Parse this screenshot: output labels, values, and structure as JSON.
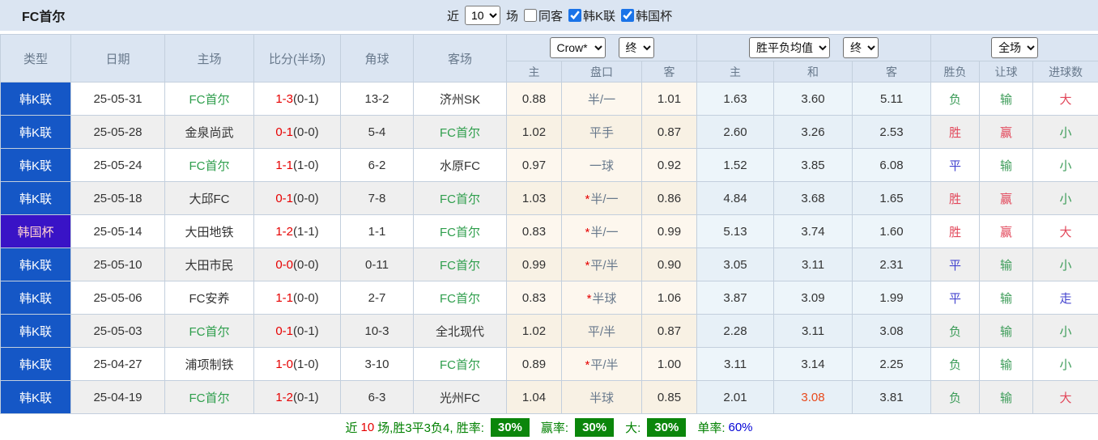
{
  "colors": {
    "league_blue": "#1557c6",
    "cup_purple": "#3913c6",
    "self_green": "#2e9e4c",
    "score_red": "#e60000",
    "result_red": "#e2475a",
    "result_green": "#3d9c59",
    "result_blue": "#4545cf",
    "mean_highlight": "#e8491c",
    "badge_green": "#0b860b"
  },
  "title": "FC首尔",
  "toolbar": {
    "near_label": "近",
    "count_value": "10",
    "games_label": "场",
    "same_away_label": "同客",
    "league_label": "韩K联",
    "cup_label": "韩国杯",
    "same_away_checked": false,
    "league_checked": true,
    "cup_checked": true
  },
  "header": {
    "col_type": "类型",
    "col_date": "日期",
    "col_home": "主场",
    "col_score": "比分(半场)",
    "col_corner": "角球",
    "col_away": "客场",
    "odds_company_select": "Crow*",
    "odds_final_select": "终",
    "mean_select": "胜平负均值",
    "mean_final_select": "终",
    "scope_select": "全场",
    "sub_odds_home": "主",
    "sub_handicap": "盘口",
    "sub_odds_away": "客",
    "sub_mean_home": "主",
    "sub_mean_draw": "和",
    "sub_mean_away": "客",
    "col_wdl": "胜负",
    "col_handicap_result": "让球",
    "col_goals": "进球数"
  },
  "rows": [
    {
      "type": "韩K联",
      "type_class": "league",
      "date": "25-05-31",
      "home": "FC首尔",
      "home_is_self": true,
      "score": "1-3",
      "half": "(0-1)",
      "corner": "13-2",
      "away": "济州SK",
      "away_is_self": false,
      "odds_home": "0.88",
      "handicap": "半/一",
      "handicap_star": false,
      "odds_away": "1.01",
      "mean_home": "1.63",
      "mean_draw": "3.60",
      "mean_away": "5.11",
      "mean_draw_highlight": false,
      "wdl": "负",
      "wdl_color": "green",
      "hr": "输",
      "hr_color": "green",
      "goals": "大",
      "goals_color": "red"
    },
    {
      "type": "韩K联",
      "type_class": "league",
      "date": "25-05-28",
      "home": "金泉尚武",
      "home_is_self": false,
      "score": "0-1",
      "half": "(0-0)",
      "corner": "5-4",
      "away": "FC首尔",
      "away_is_self": true,
      "odds_home": "1.02",
      "handicap": "平手",
      "handicap_star": false,
      "odds_away": "0.87",
      "mean_home": "2.60",
      "mean_draw": "3.26",
      "mean_away": "2.53",
      "mean_draw_highlight": false,
      "wdl": "胜",
      "wdl_color": "red",
      "hr": "赢",
      "hr_color": "red",
      "goals": "小",
      "goals_color": "green"
    },
    {
      "type": "韩K联",
      "type_class": "league",
      "date": "25-05-24",
      "home": "FC首尔",
      "home_is_self": true,
      "score": "1-1",
      "half": "(1-0)",
      "corner": "6-2",
      "away": "水原FC",
      "away_is_self": false,
      "odds_home": "0.97",
      "handicap": "一球",
      "handicap_star": false,
      "odds_away": "0.92",
      "mean_home": "1.52",
      "mean_draw": "3.85",
      "mean_away": "6.08",
      "mean_draw_highlight": false,
      "wdl": "平",
      "wdl_color": "blue",
      "hr": "输",
      "hr_color": "green",
      "goals": "小",
      "goals_color": "green"
    },
    {
      "type": "韩K联",
      "type_class": "league",
      "date": "25-05-18",
      "home": "大邱FC",
      "home_is_self": false,
      "score": "0-1",
      "half": "(0-0)",
      "corner": "7-8",
      "away": "FC首尔",
      "away_is_self": true,
      "odds_home": "1.03",
      "handicap": "半/一",
      "handicap_star": true,
      "odds_away": "0.86",
      "mean_home": "4.84",
      "mean_draw": "3.68",
      "mean_away": "1.65",
      "mean_draw_highlight": false,
      "wdl": "胜",
      "wdl_color": "red",
      "hr": "赢",
      "hr_color": "red",
      "goals": "小",
      "goals_color": "green"
    },
    {
      "type": "韩国杯",
      "type_class": "cup",
      "date": "25-05-14",
      "home": "大田地铁",
      "home_is_self": false,
      "score": "1-2",
      "half": "(1-1)",
      "corner": "1-1",
      "away": "FC首尔",
      "away_is_self": true,
      "odds_home": "0.83",
      "handicap": "半/一",
      "handicap_star": true,
      "odds_away": "0.99",
      "mean_home": "5.13",
      "mean_draw": "3.74",
      "mean_away": "1.60",
      "mean_draw_highlight": false,
      "wdl": "胜",
      "wdl_color": "red",
      "hr": "赢",
      "hr_color": "red",
      "goals": "大",
      "goals_color": "red"
    },
    {
      "type": "韩K联",
      "type_class": "league",
      "date": "25-05-10",
      "home": "大田市民",
      "home_is_self": false,
      "score": "0-0",
      "half": "(0-0)",
      "corner": "0-11",
      "away": "FC首尔",
      "away_is_self": true,
      "odds_home": "0.99",
      "handicap": "平/半",
      "handicap_star": true,
      "odds_away": "0.90",
      "mean_home": "3.05",
      "mean_draw": "3.11",
      "mean_away": "2.31",
      "mean_draw_highlight": false,
      "wdl": "平",
      "wdl_color": "blue",
      "hr": "输",
      "hr_color": "green",
      "goals": "小",
      "goals_color": "green"
    },
    {
      "type": "韩K联",
      "type_class": "league",
      "date": "25-05-06",
      "home": "FC安养",
      "home_is_self": false,
      "score": "1-1",
      "half": "(0-0)",
      "corner": "2-7",
      "away": "FC首尔",
      "away_is_self": true,
      "odds_home": "0.83",
      "handicap": "半球",
      "handicap_star": true,
      "odds_away": "1.06",
      "mean_home": "3.87",
      "mean_draw": "3.09",
      "mean_away": "1.99",
      "mean_draw_highlight": false,
      "wdl": "平",
      "wdl_color": "blue",
      "hr": "输",
      "hr_color": "green",
      "goals": "走",
      "goals_color": "blue"
    },
    {
      "type": "韩K联",
      "type_class": "league",
      "date": "25-05-03",
      "home": "FC首尔",
      "home_is_self": true,
      "score": "0-1",
      "half": "(0-1)",
      "corner": "10-3",
      "away": "全北现代",
      "away_is_self": false,
      "odds_home": "1.02",
      "handicap": "平/半",
      "handicap_star": false,
      "odds_away": "0.87",
      "mean_home": "2.28",
      "mean_draw": "3.11",
      "mean_away": "3.08",
      "mean_draw_highlight": false,
      "wdl": "负",
      "wdl_color": "green",
      "hr": "输",
      "hr_color": "green",
      "goals": "小",
      "goals_color": "green"
    },
    {
      "type": "韩K联",
      "type_class": "league",
      "date": "25-04-27",
      "home": "浦项制铁",
      "home_is_self": false,
      "score": "1-0",
      "half": "(1-0)",
      "corner": "3-10",
      "away": "FC首尔",
      "away_is_self": true,
      "odds_home": "0.89",
      "handicap": "平/半",
      "handicap_star": true,
      "odds_away": "1.00",
      "mean_home": "3.11",
      "mean_draw": "3.14",
      "mean_away": "2.25",
      "mean_draw_highlight": false,
      "wdl": "负",
      "wdl_color": "green",
      "hr": "输",
      "hr_color": "green",
      "goals": "小",
      "goals_color": "green"
    },
    {
      "type": "韩K联",
      "type_class": "league",
      "date": "25-04-19",
      "home": "FC首尔",
      "home_is_self": true,
      "score": "1-2",
      "half": "(0-1)",
      "corner": "6-3",
      "away": "光州FC",
      "away_is_self": false,
      "odds_home": "1.04",
      "handicap": "半球",
      "handicap_star": false,
      "odds_away": "0.85",
      "mean_home": "2.01",
      "mean_draw": "3.08",
      "mean_away": "3.81",
      "mean_draw_highlight": true,
      "wdl": "负",
      "wdl_color": "green",
      "hr": "输",
      "hr_color": "green",
      "goals": "大",
      "goals_color": "red"
    }
  ],
  "summary": {
    "near_label": "近",
    "count": "10",
    "record_text": "场,胜3平3负4, 胜率:",
    "win_rate": "30%",
    "profit_label": "赢率:",
    "profit_rate": "30%",
    "big_label": "大:",
    "big_rate": "30%",
    "single_label": "单率:",
    "single_rate": "60%"
  }
}
